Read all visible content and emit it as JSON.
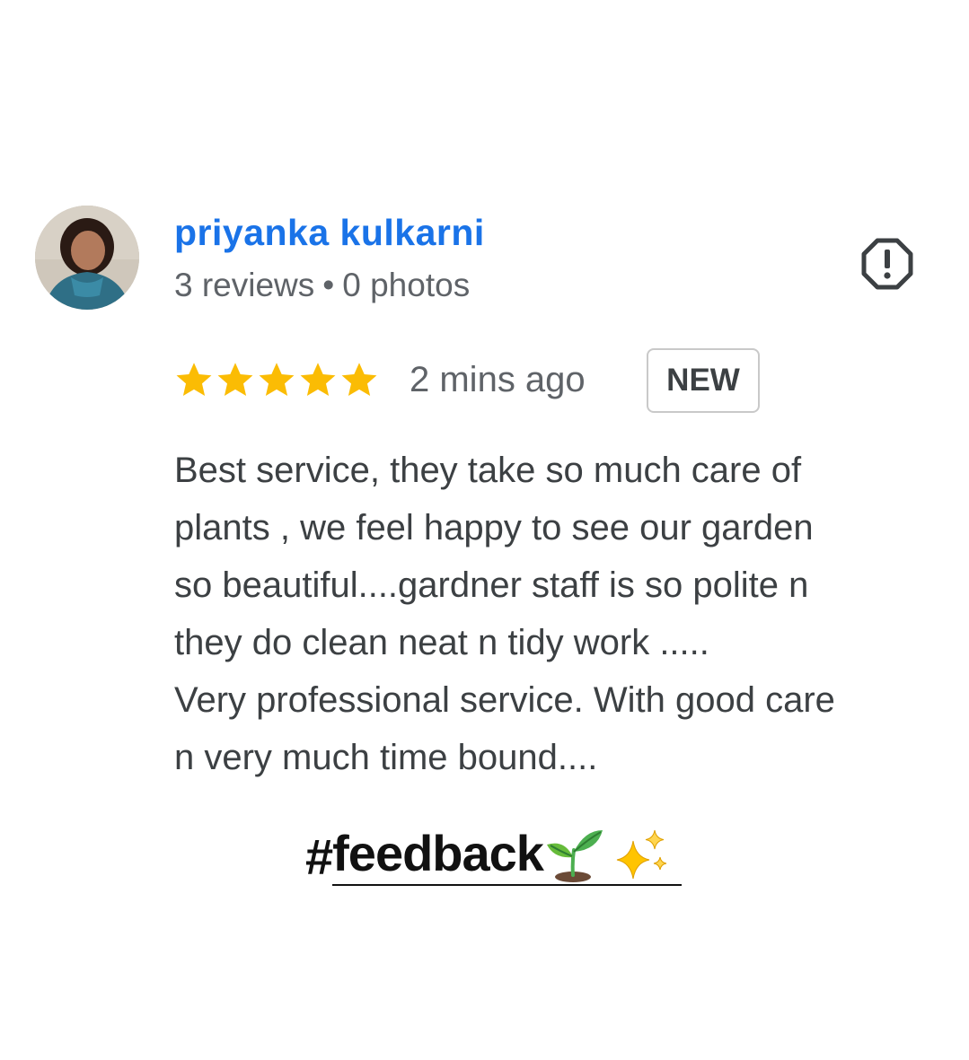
{
  "review": {
    "reviewer_name": "priyanka kulkarni",
    "reviews_count": "3 reviews",
    "separator": "•",
    "photos_count": "0 photos",
    "rating": 5,
    "time_ago": "2 mins ago",
    "badge": "NEW",
    "text_lines": [
      "Best service, they take so much care of",
      "plants , we feel happy to see our garden",
      "so beautiful....gardner staff is so polite n",
      "they do clean neat n tidy work .....",
      "Very professional service. With good care",
      "n very much time bound...."
    ]
  },
  "hashtag": {
    "hash": "#",
    "word": "feedback"
  },
  "icons": {
    "avatar": "avatar",
    "report": "report-icon",
    "star": "star-icon",
    "sprout": "seedling-emoji",
    "sparkles": "sparkles-emoji"
  },
  "colors": {
    "name": "#1a73e8",
    "meta": "#5f6368",
    "body_text": "#3c4043",
    "star": "#fbbc04"
  }
}
